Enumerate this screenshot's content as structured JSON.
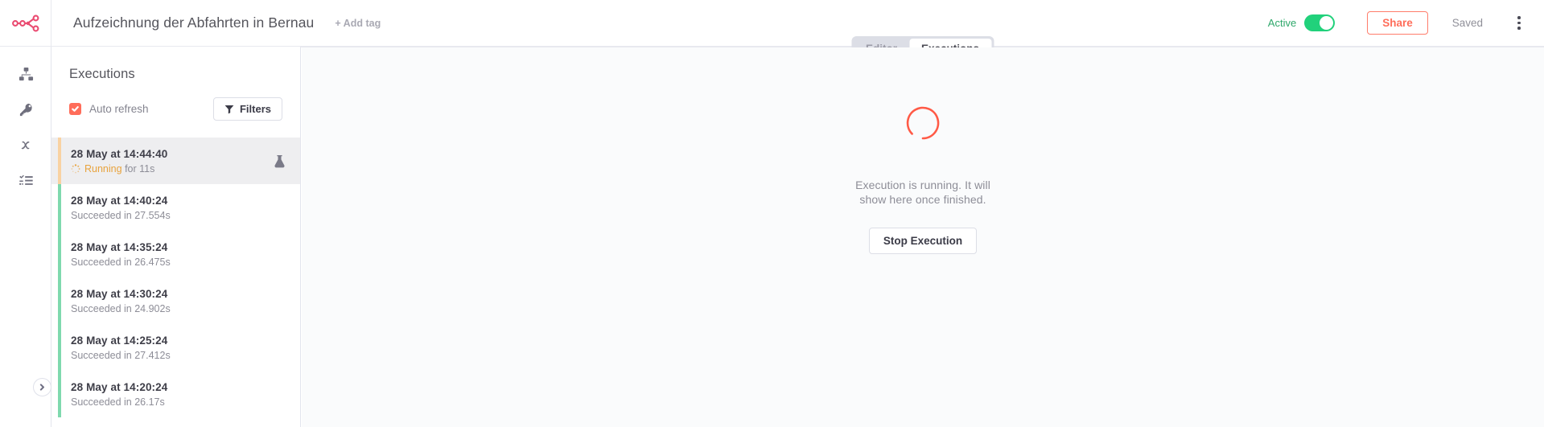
{
  "header": {
    "logo_icon": "n8n-logo-icon",
    "workflow_title": "Aufzeichnung der Abfahrten in Bernau",
    "add_tag_label": "+ Add tag",
    "active_label": "Active",
    "active_state": true,
    "share_label": "Share",
    "saved_label": "Saved",
    "menu_icon": "kebab-menu-icon",
    "accent_color": "#ff6d5a",
    "toggle_on_color": "#21d17b",
    "active_text_color": "#2fa86b"
  },
  "tabs": [
    {
      "label": "Editor",
      "active": false,
      "name": "tab-editor"
    },
    {
      "label": "Executions",
      "active": true,
      "name": "tab-executions"
    }
  ],
  "rail": {
    "items": [
      {
        "icon": "workflows-sitemap-icon",
        "name": "sidebar-item-workflows"
      },
      {
        "icon": "key-credentials-icon",
        "name": "sidebar-item-credentials"
      },
      {
        "icon": "variables-x-icon",
        "name": "sidebar-item-variables"
      },
      {
        "icon": "executions-list-icon",
        "name": "sidebar-item-executions"
      }
    ],
    "collapse_icon": "chevron-right-icon"
  },
  "sidebar": {
    "title": "Executions",
    "auto_refresh_label": "Auto refresh",
    "auto_refresh_checked": true,
    "checkbox_color": "#ff6d5a",
    "filters_label": "Filters",
    "filters_icon": "filter-funnel-icon",
    "running_bar_color": "#f9d2a2",
    "success_bar_color": "#7fd9ae",
    "executions": [
      {
        "time": "28 May at 14:44:40",
        "status": "Running",
        "status_suffix": "for 11s",
        "state": "running",
        "selected": true,
        "has_flask_icon": true,
        "flask_icon": "flask-test-icon"
      },
      {
        "time": "28 May at 14:40:24",
        "status_text": "Succeeded in 27.554s",
        "state": "success",
        "selected": false,
        "has_flask_icon": false
      },
      {
        "time": "28 May at 14:35:24",
        "status_text": "Succeeded in 26.475s",
        "state": "success",
        "selected": false,
        "has_flask_icon": false
      },
      {
        "time": "28 May at 14:30:24",
        "status_text": "Succeeded in 24.902s",
        "state": "success",
        "selected": false,
        "has_flask_icon": false
      },
      {
        "time": "28 May at 14:25:24",
        "status_text": "Succeeded in 27.412s",
        "state": "success",
        "selected": false,
        "has_flask_icon": false
      },
      {
        "time": "28 May at 14:20:24",
        "status_text": "Succeeded in 26.17s",
        "state": "success",
        "selected": false,
        "has_flask_icon": false
      }
    ]
  },
  "main": {
    "spinner_icon": "loading-spinner-icon",
    "spinner_color": "#ff6d5a",
    "message_line1": "Execution is running. It will",
    "message_line2": "show here once finished.",
    "stop_button_label": "Stop Execution"
  }
}
